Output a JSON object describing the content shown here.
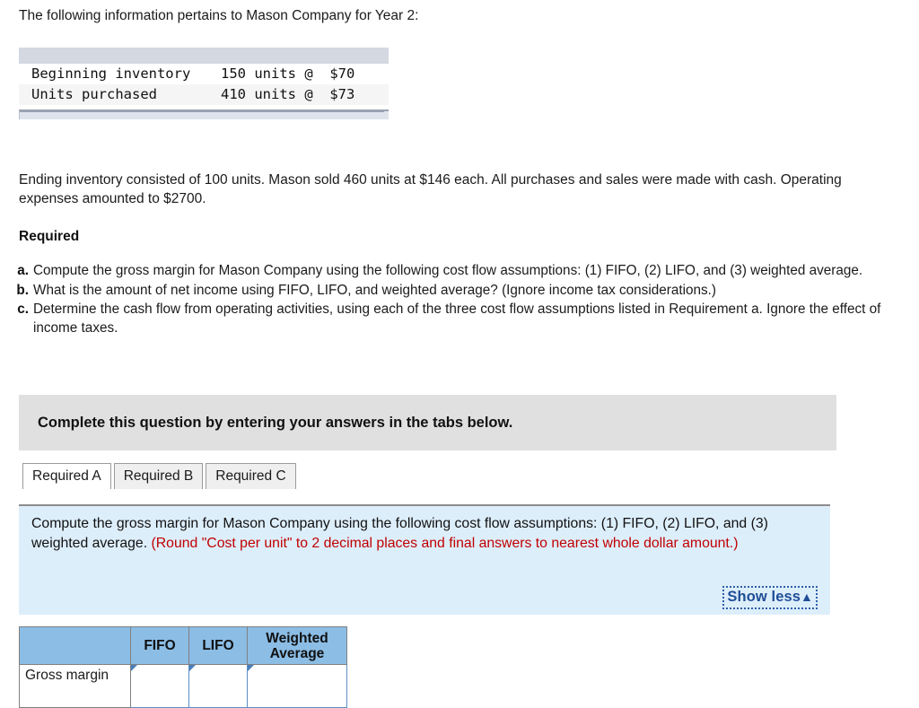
{
  "intro": {
    "text": "The following information pertains to Mason Company for Year 2:"
  },
  "data_table": {
    "rows": [
      {
        "label": "Beginning inventory",
        "value": "150 units @  $70"
      },
      {
        "label": "Units purchased",
        "value": "410 units @  $73"
      }
    ],
    "scrollbar": "horizontal-scrollbar"
  },
  "paragraph": {
    "text": "Ending inventory consisted of 100 units. Mason sold 460 units at $146 each. All purchases and sales were made with cash. Operating expenses amounted to $2700."
  },
  "required_heading": "Required",
  "requirements": [
    {
      "marker": "a.",
      "text": "Compute the gross margin for Mason Company using the following cost flow assumptions: (1) FIFO, (2) LIFO, and (3) weighted average."
    },
    {
      "marker": "b.",
      "text": "What is the amount of net income using FIFO, LIFO, and weighted average? (Ignore income tax considerations.)"
    },
    {
      "marker": "c.",
      "text": "Determine the cash flow from operating activities, using each of the three cost flow assumptions listed in Requirement a. Ignore the effect of income taxes."
    }
  ],
  "banner": {
    "text": "Complete this question by entering your answers in the tabs below."
  },
  "tabs": [
    {
      "label": "Required A",
      "active": true
    },
    {
      "label": "Required B",
      "active": false
    },
    {
      "label": "Required C",
      "active": false
    }
  ],
  "instruction_panel": {
    "black_text": "Compute the gross margin for Mason Company using the following cost flow assumptions: (1) FIFO, (2) LIFO, and (3) weighted average. ",
    "red_text": "(Round \"Cost per unit\" to 2 decimal places and final answers to nearest whole dollar amount.)",
    "show_less_label": "Show less",
    "show_less_caret": "▲"
  },
  "answer_table": {
    "headers": [
      "",
      "FIFO",
      "LIFO",
      "Weighted Average"
    ],
    "rows": [
      {
        "label": "Gross margin",
        "cells": [
          "",
          "",
          ""
        ]
      }
    ]
  },
  "colors": {
    "banner_gray": "#e0e0e0",
    "panel_blue": "#ddeefb",
    "table_header_blue": "#8bbde5",
    "data_header_bluegray": "#d3d8e1",
    "red_note": "#c00000",
    "link_blue": "#1f4e96"
  }
}
